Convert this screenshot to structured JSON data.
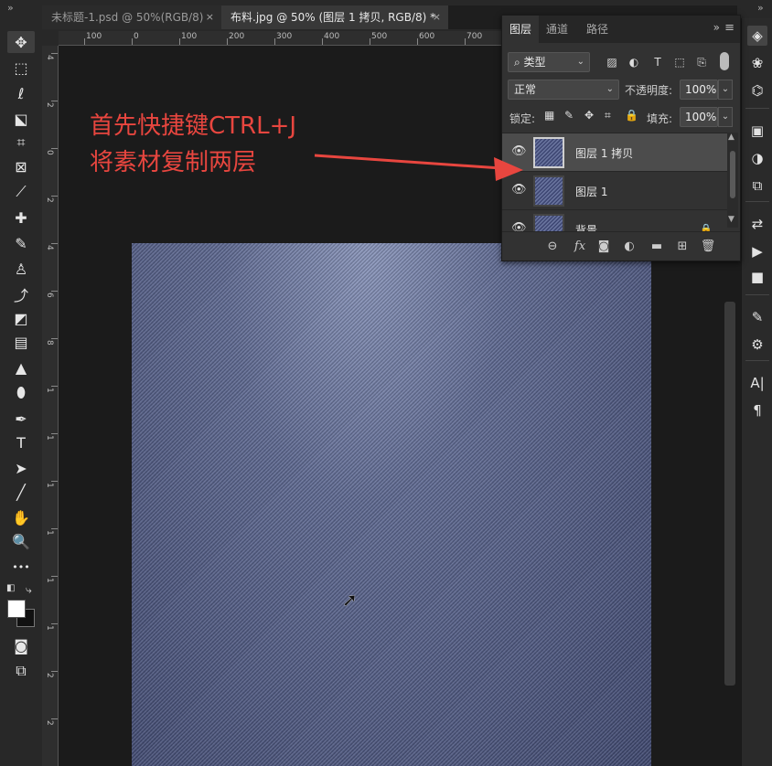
{
  "window": {
    "collapse_left": "»",
    "collapse_right": "»"
  },
  "tabs": [
    {
      "label": "未标题-1.psd @ 50%(RGB/8)",
      "close": "×"
    },
    {
      "label": "布料.jpg @ 50% (图层 1 拷贝, RGB/8) *",
      "close": "×"
    }
  ],
  "ruler_top": [
    "100",
    "0",
    "100",
    "200",
    "300",
    "400",
    "500",
    "600",
    "700"
  ],
  "ruler_left": [
    "4",
    "2",
    "0",
    "2",
    "4",
    "6",
    "8",
    "1",
    "1",
    "1",
    "1",
    "1",
    "1",
    "2",
    "2",
    "2"
  ],
  "toolbar": {
    "tools": [
      {
        "icon": "move-icon",
        "glyph": "✥"
      },
      {
        "icon": "marquee-icon",
        "glyph": "⬚"
      },
      {
        "icon": "lasso-icon",
        "glyph": "ℓ"
      },
      {
        "icon": "object-select-icon",
        "glyph": "⬕"
      },
      {
        "icon": "crop-icon",
        "glyph": "⌗"
      },
      {
        "icon": "frame-icon",
        "glyph": "⊠"
      },
      {
        "icon": "eyedropper-icon",
        "glyph": "⟋"
      },
      {
        "icon": "healing-icon",
        "glyph": "✚"
      },
      {
        "icon": "brush-icon",
        "glyph": "✎"
      },
      {
        "icon": "stamp-icon",
        "glyph": "♙"
      },
      {
        "icon": "history-brush-icon",
        "glyph": "⤴"
      },
      {
        "icon": "eraser-icon",
        "glyph": "◩"
      },
      {
        "icon": "gradient-icon",
        "glyph": "▤"
      },
      {
        "icon": "blur-icon",
        "glyph": "▲"
      },
      {
        "icon": "dodge-icon",
        "glyph": "⬮"
      },
      {
        "icon": "pen-icon",
        "glyph": "✒"
      },
      {
        "icon": "type-icon",
        "glyph": "T"
      },
      {
        "icon": "path-select-icon",
        "glyph": "➤"
      },
      {
        "icon": "line-icon",
        "glyph": "╱"
      },
      {
        "icon": "hand-icon",
        "glyph": "✋"
      },
      {
        "icon": "zoom-icon",
        "glyph": "🔍"
      },
      {
        "icon": "more-tools-icon",
        "glyph": "•••"
      }
    ],
    "swap_glyph": "⤷",
    "default_glyph": "◧",
    "quickmask_glyph": "◙",
    "screenmode_glyph": "⧉"
  },
  "annotation": {
    "line1": "首先快捷键CTRL+J",
    "line2": "将素材复制两层",
    "color": "#e8463f"
  },
  "layers_panel": {
    "tabs": [
      "图层",
      "通道",
      "路径"
    ],
    "collapse": "»",
    "menu": "≡",
    "filter_label": "类型",
    "blend_mode": "正常",
    "opacity_label": "不透明度:",
    "opacity_value": "100%",
    "lock_label": "锁定:",
    "fill_label": "填充:",
    "fill_value": "100%",
    "layers": [
      {
        "name": "图层 1 拷贝",
        "selected": true
      },
      {
        "name": "图层 1",
        "selected": false
      },
      {
        "name": "背景",
        "selected": false
      }
    ],
    "footer_icons": [
      "link-icon",
      "fx-icon",
      "mask-icon",
      "adjustment-icon",
      "group-folder-icon",
      "new-layer-icon",
      "trash-icon"
    ],
    "footer_glyphs": [
      "⊖",
      "fx",
      "◙",
      "◐",
      "▬",
      "⊞",
      "🗑"
    ]
  },
  "dock_right": {
    "icons": [
      {
        "name": "layers-dock-icon",
        "glyph": "◈"
      },
      {
        "name": "color-dock-icon",
        "glyph": "❀"
      },
      {
        "name": "paths-dock-icon",
        "glyph": "⌬"
      },
      {
        "name": "library-dock-icon",
        "glyph": "▣"
      },
      {
        "name": "adjust-dock-icon",
        "glyph": "◑"
      },
      {
        "name": "properties-dock-icon",
        "glyph": "⧉"
      },
      {
        "name": "history-dock-icon",
        "glyph": "⇄"
      },
      {
        "name": "actions-dock-icon",
        "glyph": "▶"
      },
      {
        "name": "comments-dock-icon",
        "glyph": "■"
      },
      {
        "name": "brushes-dock-icon",
        "glyph": "✎"
      },
      {
        "name": "settings-dock-icon",
        "glyph": "⚙"
      },
      {
        "name": "character-dock-icon",
        "glyph": "A|"
      },
      {
        "name": "paragraph-dock-icon",
        "glyph": "¶"
      }
    ]
  }
}
